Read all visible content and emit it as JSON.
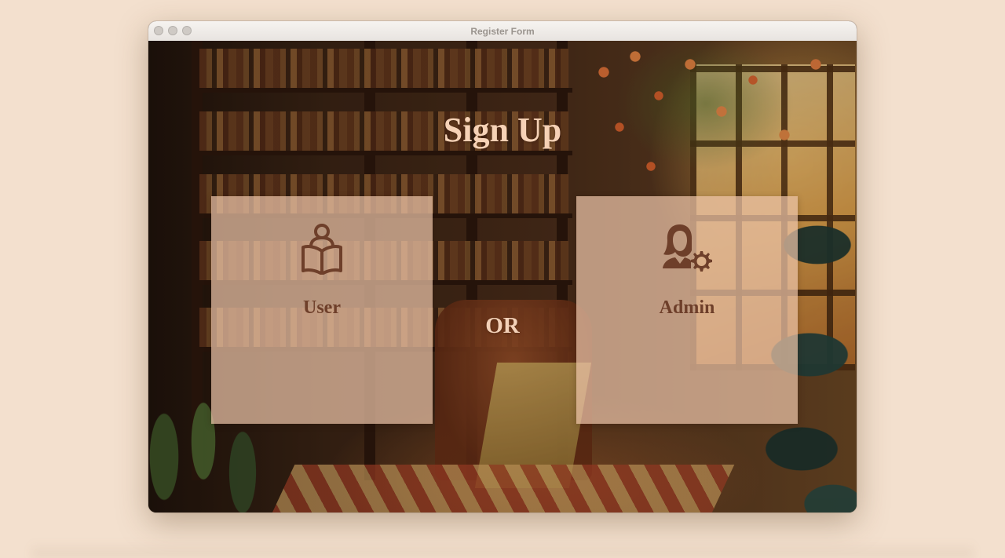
{
  "window": {
    "title": "Register Form"
  },
  "page": {
    "heading": "Sign Up",
    "separator": "OR"
  },
  "options": [
    {
      "label": "User",
      "icon": "user-reading-book-icon"
    },
    {
      "label": "Admin",
      "icon": "admin-gear-icon"
    }
  ],
  "colors": {
    "desktop_bg": "#f3e0ce",
    "heading": "#f6d2b6",
    "card_bg": "#ecc4a8",
    "card_text": "#6e3f2a",
    "icon": "#6e3f2a"
  }
}
